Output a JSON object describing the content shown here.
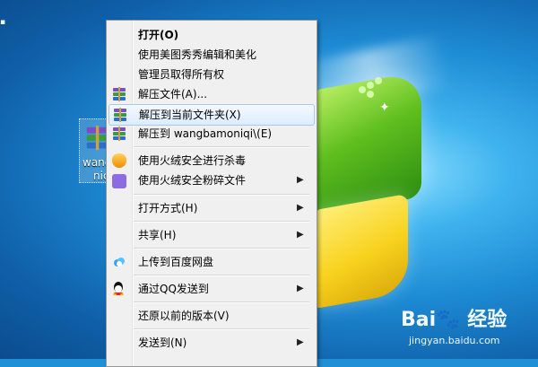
{
  "desktop": {
    "icon_label_lines": [
      "wang",
      "nic"
    ]
  },
  "context_menu": {
    "items": [
      {
        "label": "打开(O)",
        "bold": true
      },
      {
        "label": "使用美图秀秀编辑和美化"
      },
      {
        "label": "管理员取得所有权"
      },
      {
        "label": "解压文件(A)...",
        "icon": "winrar-icon"
      },
      {
        "label": "解压到当前文件夹(X)",
        "icon": "winrar-icon",
        "highlighted": true
      },
      {
        "label": "解压到 wangbamoniqi\\(E)",
        "icon": "winrar-icon"
      },
      {
        "label": "使用火绒安全进行杀毒",
        "icon": "huorong-shield-icon"
      },
      {
        "label": "使用火绒安全粉碎文件",
        "icon": "shredder-icon",
        "submenu": true
      },
      {
        "label": "打开方式(H)",
        "submenu": true
      },
      {
        "label": "共享(H)",
        "submenu": true
      },
      {
        "label": "上传到百度网盘",
        "icon": "baidu-cloud-icon"
      },
      {
        "label": "通过QQ发送到",
        "icon": "qq-icon",
        "submenu": true
      },
      {
        "label": "还原以前的版本(V)"
      },
      {
        "label": "发送到(N)",
        "submenu": true
      }
    ]
  },
  "watermark": {
    "logo_text": "Bai🐾 经验",
    "site_text": "jingyan.baidu.com"
  },
  "colors": {
    "menu_background": "#f0f0f0",
    "highlight_border": "#a9c9ef",
    "desktop_blue": "#1d8bd4"
  }
}
